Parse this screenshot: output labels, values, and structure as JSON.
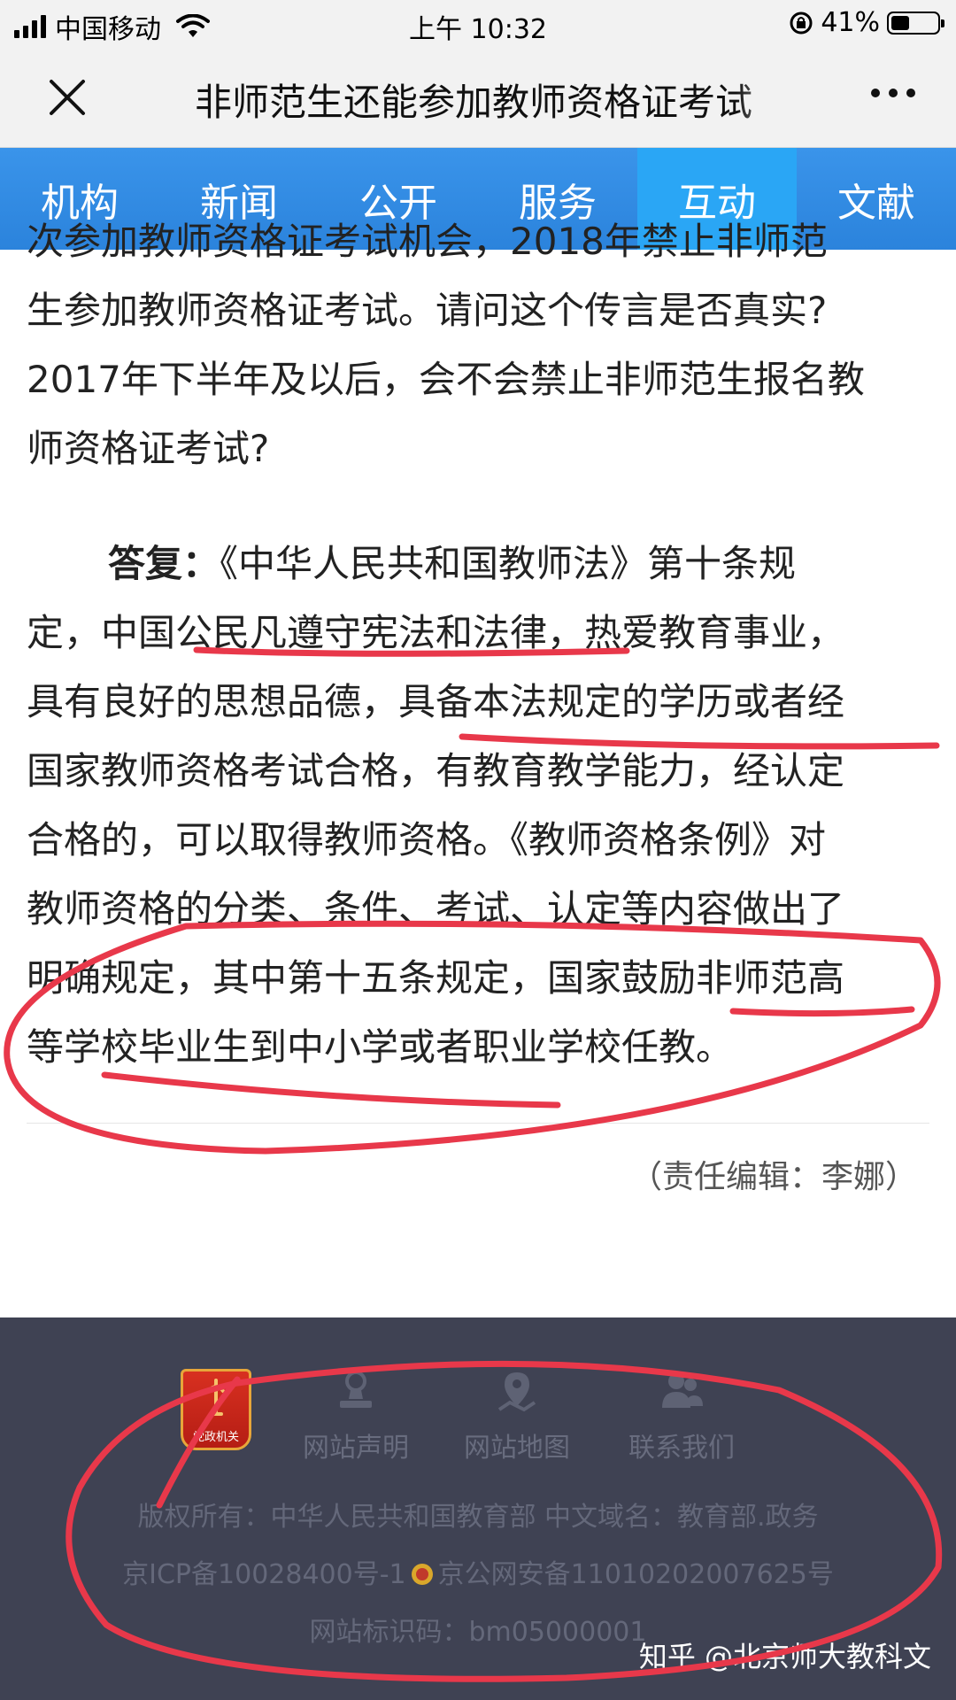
{
  "status_bar": {
    "carrier": "中国移动",
    "time": "上午 10:32",
    "battery_text": "41%",
    "battery_level": 0.41
  },
  "title_bar": {
    "title": "非师范生还能参加教师资格证考试"
  },
  "nav": {
    "items": [
      "机构",
      "新闻",
      "公开",
      "服务",
      "互动",
      "文献"
    ],
    "active_index": 4
  },
  "article": {
    "question_lines": [
      "次参加教师资格证考试机会，2018年禁止非师范",
      "生参加教师资格证考试。请问这个传言是否真实?",
      "2017年下半年及以后，会不会禁止非师范生报名教",
      "师资格证考试?"
    ],
    "answer_label": "答复：",
    "answer_lines": [
      "《中华人民共和国教师法》第十条规",
      "定，中国公民凡遵守宪法和法律，热爱教育事业，",
      "具有良好的思想品德，具备本法规定的学历或者经",
      "国家教师资格考试合格，有教育教学能力，经认定",
      "合格的，可以取得教师资格。《教师资格条例》对",
      "教师资格的分类、条件、考试、认定等内容做出了",
      "明确规定，其中第十五条规定，国家鼓励非师范高",
      "等学校毕业生到中小学或者职业学校任教。"
    ],
    "editor": "（责任编辑：李娜）"
  },
  "footer": {
    "badge_text": "党政机关",
    "links": [
      "网站声明",
      "网站地图",
      "联系我们"
    ],
    "copyright": "版权所有：中华人民共和国教育部 中文域名：教育部.政务",
    "icp": "京ICP备10028400号-1",
    "police": "京公网安备11010202007625号",
    "site_code": "网站标识码：bm05000001",
    "watermark": "知乎 @北京师大教科文"
  },
  "colors": {
    "nav_bg": "#2b83dc",
    "nav_active": "#2aa6f5",
    "footer_bg": "#3f4253",
    "annotation": "#e8384a"
  },
  "icons": [
    "signal-icon",
    "wifi-icon",
    "rotation-lock-icon",
    "battery-icon",
    "close-icon",
    "more-icon",
    "seal-icon",
    "map-pin-icon",
    "contact-icon",
    "police-badge-icon"
  ]
}
